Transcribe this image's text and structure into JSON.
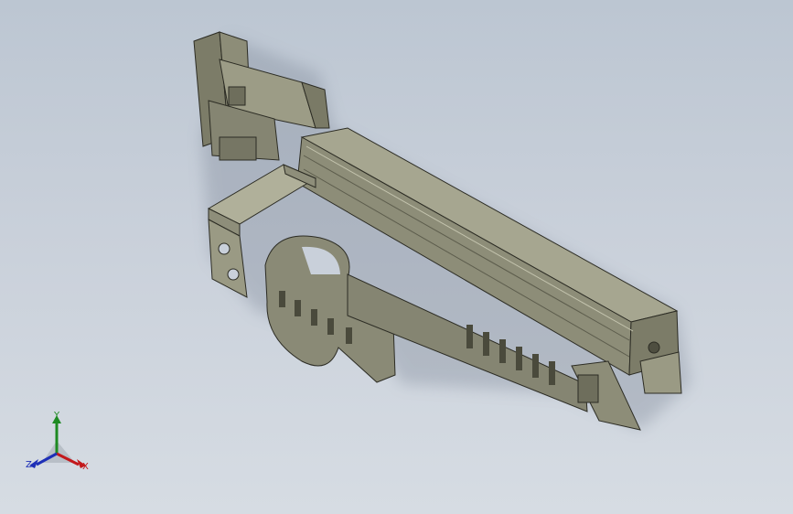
{
  "viewport": {
    "background_top": "#bcc6d2",
    "background_bottom": "#d6dce3",
    "model_color": "#8a8a78"
  },
  "triad": {
    "x_label": "X",
    "y_label": "Y",
    "z_label": "Z",
    "x_color": "#c3181b",
    "y_color": "#1e8a22",
    "z_color": "#1d2fb7"
  }
}
